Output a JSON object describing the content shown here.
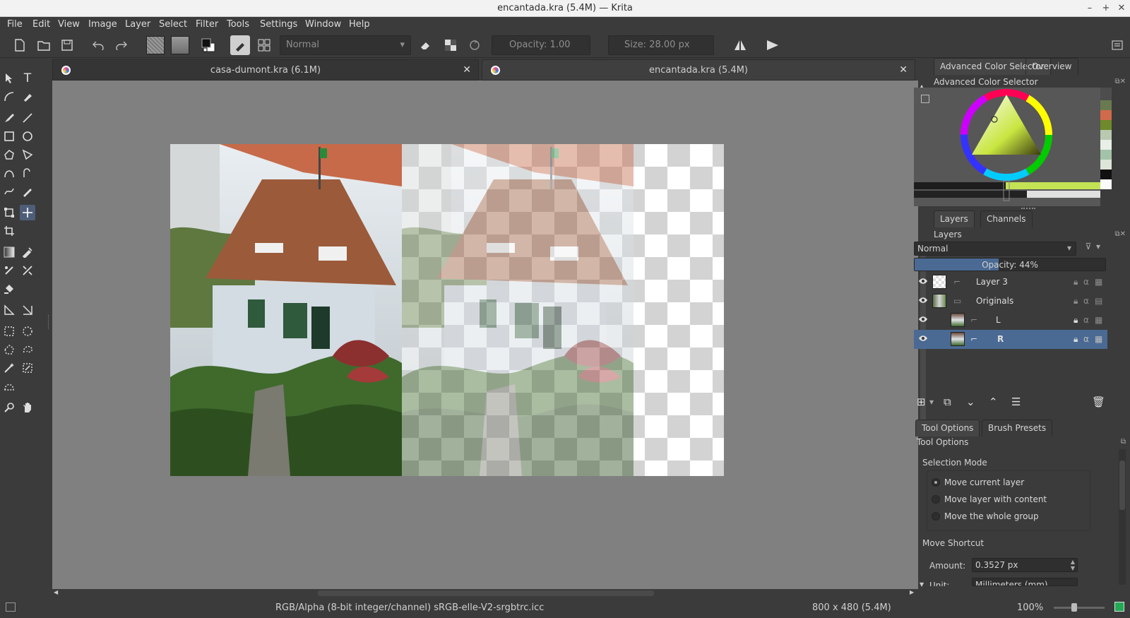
{
  "window": {
    "title": "encantada.kra (5.4M) — Krita"
  },
  "menu": [
    "File",
    "Edit",
    "View",
    "Image",
    "Layer",
    "Select",
    "Filter",
    "Tools",
    "Settings",
    "Window",
    "Help"
  ],
  "toolbar": {
    "blend_mode": "Normal",
    "opacity_label": "Opacity:",
    "opacity_value": "1.00",
    "size_label": "Size:",
    "size_value": "28.00 px"
  },
  "tabs": [
    {
      "label": "casa-dumont.kra (6.1M)"
    },
    {
      "label": "encantada.kra (5.4M)"
    }
  ],
  "docker": {
    "color_tabs": [
      "Advanced Color Selector",
      "Overview"
    ],
    "color_title": "Advanced Color Selector",
    "layer_tabs": [
      "Layers",
      "Channels"
    ],
    "layers_title": "Layers",
    "blend_mode": "Normal",
    "opacity_label": "Opacity:",
    "opacity_value": "44%",
    "opacity_fraction": 0.44,
    "layers": [
      {
        "name": "Layer 3",
        "selected": false
      },
      {
        "name": "Originals",
        "selected": false
      },
      {
        "name": "L",
        "selected": false
      },
      {
        "name": "R",
        "selected": true
      }
    ],
    "tool_tabs": [
      "Tool Options",
      "Brush Presets"
    ],
    "tool_title": "Tool Options",
    "selection_mode_label": "Selection Mode",
    "selection_modes": [
      {
        "label": "Move current layer",
        "checked": true
      },
      {
        "label": "Move layer with content",
        "checked": false
      },
      {
        "label": "Move the whole group",
        "checked": false
      }
    ],
    "move_shortcut_label": "Move Shortcut",
    "amount_label": "Amount:",
    "amount_value": "0.3527 px",
    "unit_label": "Unit:",
    "unit_value": "Millimeters (mm)"
  },
  "status": {
    "color_space": "RGB/Alpha (8-bit integer/channel)  sRGB-elle-V2-srgbtrc.icc",
    "dimensions": "800 x 480 (5.4M)",
    "zoom": "100%"
  },
  "colors": {
    "selection": "#4a6a94",
    "canvas_bg": "#808080",
    "panel": "#3b3b3b"
  }
}
